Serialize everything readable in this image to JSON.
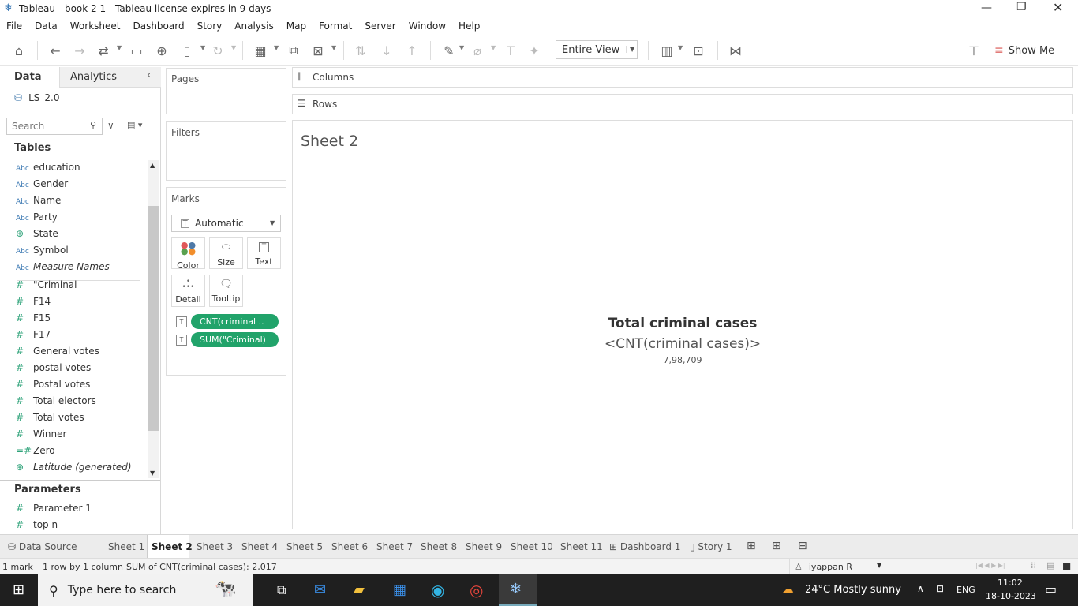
{
  "window": {
    "title": "Tableau - book 2 1 - Tableau license expires in 9 days"
  },
  "menu": [
    "File",
    "Data",
    "Worksheet",
    "Dashboard",
    "Story",
    "Analysis",
    "Map",
    "Format",
    "Server",
    "Window",
    "Help"
  ],
  "toolbar": {
    "view_mode": "Entire View",
    "show_me": "Show Me"
  },
  "data_pane": {
    "tab_data": "Data",
    "tab_analytics": "Analytics",
    "datasource": "LS_2.0",
    "search_placeholder": "Search",
    "tables_heading": "Tables",
    "dimensions": [
      {
        "type": "Abc",
        "name": "education"
      },
      {
        "type": "Abc",
        "name": "Gender"
      },
      {
        "type": "Abc",
        "name": "Name"
      },
      {
        "type": "Abc",
        "name": "Party"
      },
      {
        "type": "globe",
        "name": "State"
      },
      {
        "type": "Abc",
        "name": "Symbol"
      },
      {
        "type": "Abc",
        "name": "Measure Names"
      }
    ],
    "measures": [
      {
        "type": "#",
        "name": "\"Criminal"
      },
      {
        "type": "#",
        "name": "F14"
      },
      {
        "type": "#",
        "name": "F15"
      },
      {
        "type": "#",
        "name": "F17"
      },
      {
        "type": "#",
        "name": "General votes"
      },
      {
        "type": "#",
        "name": "postal votes"
      },
      {
        "type": "#",
        "name": "Postal votes"
      },
      {
        "type": "#",
        "name": "Total electors"
      },
      {
        "type": "#",
        "name": "Total votes"
      },
      {
        "type": "#",
        "name": "Winner"
      },
      {
        "type": "=#",
        "name": "Zero"
      },
      {
        "type": "globe",
        "name": "Latitude (generated)"
      }
    ],
    "parameters_heading": "Parameters",
    "parameters": [
      {
        "type": "#",
        "name": "Parameter 1"
      },
      {
        "type": "#",
        "name": "top n"
      }
    ]
  },
  "shelves": {
    "pages": "Pages",
    "filters": "Filters",
    "marks": "Marks",
    "columns": "Columns",
    "rows": "Rows"
  },
  "marks": {
    "type": "Automatic",
    "buttons": [
      "Color",
      "Size",
      "Text",
      "Detail",
      "Tooltip"
    ],
    "pills": [
      "CNT(criminal ..",
      "SUM(\"Criminal)"
    ]
  },
  "view": {
    "sheet_title": "Sheet 2",
    "label_title": "Total criminal cases",
    "label_field": "<CNT(criminal cases)>",
    "label_value": "7,98,709"
  },
  "tabs": [
    "Data Source",
    "Sheet 1",
    "Sheet 2",
    "Sheet 3",
    "Sheet 4",
    "Sheet 5",
    "Sheet 6",
    "Sheet 7",
    "Sheet 8",
    "Sheet 9",
    "Sheet 10",
    "Sheet 11",
    "Dashboard 1",
    "Story 1"
  ],
  "active_tab": "Sheet 2",
  "status": {
    "marks": "1 mark",
    "dims": "1 row by 1 column",
    "sum": "SUM of CNT(criminal cases): 2,017",
    "user": "iyappan R"
  },
  "taskbar": {
    "search_placeholder": "Type here to search",
    "weather": "24°C  Mostly sunny",
    "lang": "ENG",
    "time": "11:02",
    "date": "18-10-2023"
  }
}
